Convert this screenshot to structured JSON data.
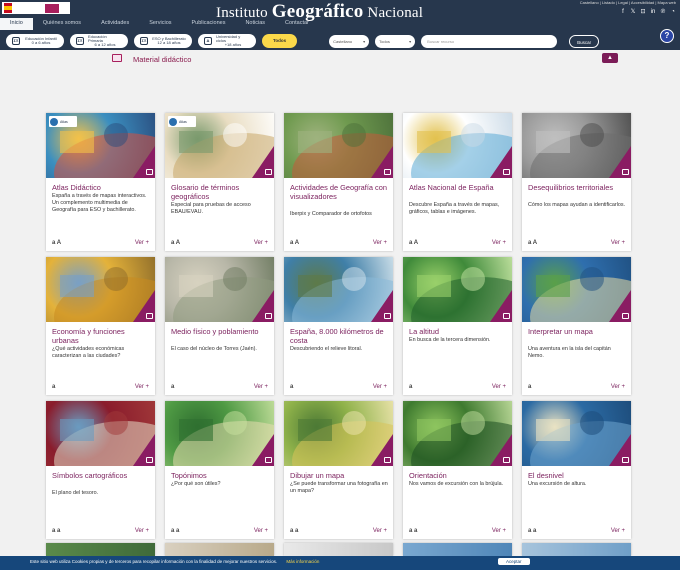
{
  "header": {
    "title_prefix": "Instituto",
    "title_main": "Geográfico",
    "title_suffix": "Nacional",
    "top_links": "Castellano | Listado | Legal | Accesibilidad | Mapa web",
    "menu": [
      "Inicio",
      "Quiénes somos",
      "Actividades",
      "Servicios",
      "Publicaciones",
      "Noticias",
      "Contactar"
    ]
  },
  "filters": {
    "levels": [
      {
        "icon": "ΣΞ",
        "line1": "Educación Infantil",
        "line2": "0 a 6 años"
      },
      {
        "icon": "ΣΞ",
        "line1": "Educación Primaria",
        "line2": "6 a 12 años"
      },
      {
        "icon": "ΣΞ",
        "line1": "ESO y Bachillerato",
        "line2": "12 a 18 años"
      },
      {
        "icon": "A",
        "line1": "Universidad y ciclos",
        "line2": "+18 años"
      }
    ],
    "todos": "Todos",
    "language_select": "Castellano",
    "type_select": "Todos",
    "search_placeholder": "Buscar recurso",
    "search_button": "Buscar",
    "help": "?"
  },
  "section": {
    "title": "Material didáctico",
    "collapse": "▲"
  },
  "cards": [
    {
      "title": "Atlas Didáctico",
      "desc": "España a través de mapas interactivos. Un complemento multimedia de Geografía para ESO y bachillerato.",
      "icons": "a  A",
      "more": "Ver +",
      "colors": [
        "#3b8fc0",
        "#d94f3d",
        "#f3c24a",
        "#2a4b7c"
      ],
      "atlas": "Atlas"
    },
    {
      "title": "Glosario de términos geográficos",
      "desc": "Especial para pruebas de acceso EBAU/EVAU.",
      "icons": "a  A",
      "more": "Ver +",
      "colors": [
        "#e9ddc2",
        "#c9a76a",
        "#7a9a6d",
        "#ffffff"
      ],
      "atlas": "Atlas"
    },
    {
      "title": "Actividades de Geografía con visualizadores",
      "desc": "Iberpix y Comparador de ortofotos",
      "icons": "a  A",
      "more": "Ver +",
      "colors": [
        "#6f9a4f",
        "#c45a3a",
        "#9fb37e",
        "#4c6f3a"
      ],
      "atlas": ""
    },
    {
      "title": "Atlas Nacional de España",
      "desc": "Descubre España a través de mapas, gráficos, tablas e imágenes.",
      "icons": "a  A",
      "more": "Ver +",
      "colors": [
        "#ffffff",
        "#5aa9d6",
        "#e2c14e",
        "#c9d9e6"
      ],
      "atlas": ""
    },
    {
      "title": "Desequilibrios territoriales",
      "desc": "Cómo los mapas ayudan a identificarlos.",
      "icons": "a  A",
      "more": "Ver +",
      "colors": [
        "#9a9a9a",
        "#6d6d6d",
        "#bfbfbf",
        "#4a4a4a"
      ],
      "atlas": ""
    },
    {
      "title": "Economía y funciones urbanas",
      "desc": "¿Qué actividades económicas caracterizan a las ciudades?",
      "icons": "a",
      "more": "Ver +",
      "colors": [
        "#e4b23a",
        "#c88a1f",
        "#7aa0c4",
        "#8b6a2a"
      ],
      "atlas": ""
    },
    {
      "title": "Medio físico y poblamiento",
      "desc": "El caso del núcleo de Torres (Jaén).",
      "icons": "a",
      "more": "Ver +",
      "colors": [
        "#b8b7a8",
        "#8f9a7f",
        "#d7d2c0",
        "#6d7a60"
      ],
      "atlas": ""
    },
    {
      "title": "España, 8.000 kilómetros de costa",
      "desc": "Descubriendo el relieve litoral.",
      "icons": "a",
      "more": "Ver +",
      "colors": [
        "#3f7fa8",
        "#8ab9d8",
        "#5d7a4a",
        "#d7e6ee"
      ],
      "atlas": ""
    },
    {
      "title": "La altitud",
      "desc": "En busca de la tercera dimensión.",
      "icons": "a",
      "more": "Ver +",
      "colors": [
        "#3f8a3a",
        "#1f5e2a",
        "#9ad06a",
        "#c8e6a5"
      ],
      "atlas": ""
    },
    {
      "title": "Interpretar un mapa",
      "desc": "Una aventura en la isla del capitán Nemo.",
      "icons": "a",
      "more": "Ver +",
      "colors": [
        "#2f6fae",
        "#e9dca4",
        "#5aa04a",
        "#1f4f80"
      ],
      "atlas": ""
    },
    {
      "title": "Símbolos cartográficos",
      "desc": "El plano del tesoro.",
      "icons": "a  a",
      "more": "Ver +",
      "colors": [
        "#8a1c2c",
        "#e6dfc8",
        "#6a9bc0",
        "#a23a3a"
      ],
      "atlas": ""
    },
    {
      "title": "Topónimos",
      "desc": "¿Por qué son útiles?",
      "icons": "a  a",
      "more": "Ver +",
      "colors": [
        "#4f9a44",
        "#e8dcb0",
        "#2f6f30",
        "#c9e2a0"
      ],
      "atlas": ""
    },
    {
      "title": "Dibujar un mapa",
      "desc": "¿Se puede transformar una fotografía en un mapa?",
      "icons": "a  a",
      "more": "Ver +",
      "colors": [
        "#8fb24a",
        "#d9c35a",
        "#4d7a35",
        "#f0e6b0"
      ],
      "atlas": ""
    },
    {
      "title": "Orientación",
      "desc": "Nos vamos de excursión con la brújula.",
      "icons": "a  a",
      "more": "Ver +",
      "colors": [
        "#3e7a2f",
        "#1e4f22",
        "#8ec45f",
        "#c4dfa0"
      ],
      "atlas": ""
    },
    {
      "title": "El desnivel",
      "desc": "Una excursión de altura.",
      "icons": "a  a",
      "more": "Ver +",
      "colors": [
        "#2b6aa3",
        "#6fa5d0",
        "#e9e2c3",
        "#1c4a78"
      ],
      "atlas": ""
    }
  ],
  "cookie": {
    "text": "Este sitio web utiliza Cookies propias y de terceros para recopilar información con la finalidad de mejorar nuestros servicios.",
    "more": "Más información",
    "accept": "Aceptar"
  }
}
